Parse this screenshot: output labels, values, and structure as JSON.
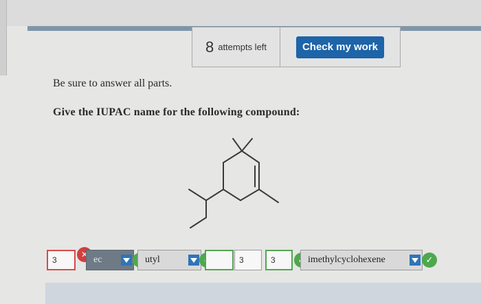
{
  "toolbar": {
    "attempts_count": "8",
    "attempts_label": "attempts left",
    "check_button_label": "Check my work"
  },
  "instruction": "Be sure to answer all parts.",
  "question": "Give the IUPAC name for the following compound:",
  "answers": {
    "locant1": "3",
    "prefix1": "ec",
    "name1": "utyl",
    "locant2": "",
    "locant3": "3",
    "locant4": "3",
    "name2": "imethylcyclohexene"
  },
  "colors": {
    "check_button": "#1d64a8",
    "correct": "#4ea84e",
    "incorrect": "#d23f3f",
    "dropdown_arrow": "#2f74b9"
  }
}
